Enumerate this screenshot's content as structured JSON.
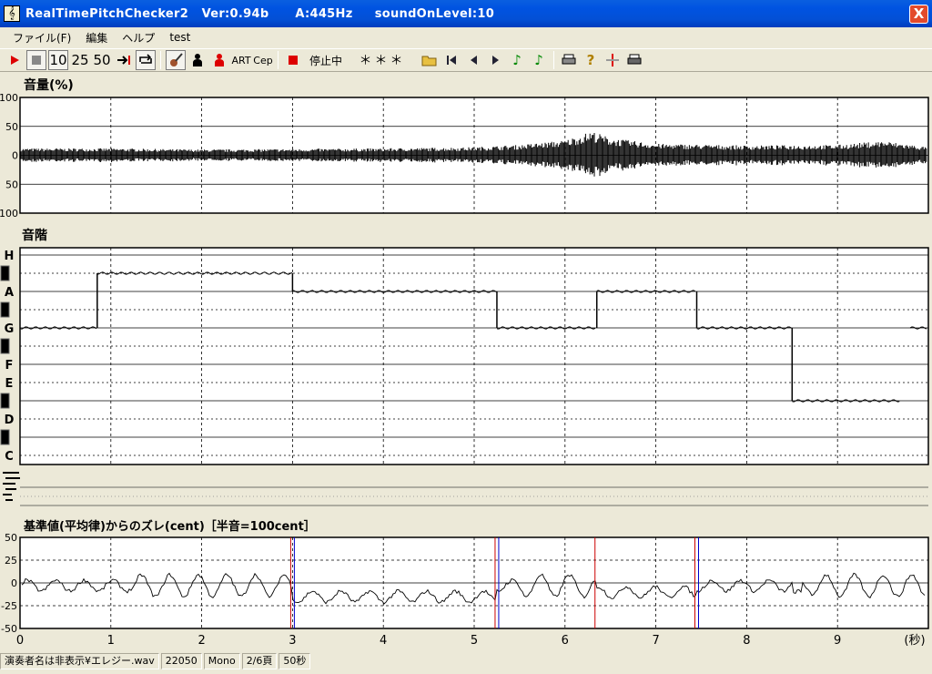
{
  "window": {
    "title": "RealTimePitchChecker2   Ver:0.94b      A:445Hz     soundOnLevel:10",
    "app_icon": "treble-clef-icon",
    "close_label": "X"
  },
  "menu": [
    "ファイル(F)",
    "編集",
    "ヘルプ",
    "test"
  ],
  "toolbar": {
    "play": "play-icon",
    "stop": "stop-icon",
    "speed": [
      "10",
      "25",
      "50"
    ],
    "art": "ART",
    "cep": "Cep",
    "state": "停止中",
    "pitch_display": "＊＊＊"
  },
  "panels": {
    "volume": {
      "title": "音量(%)",
      "y_ticks": [
        "100",
        "50",
        "0",
        "50",
        "100"
      ]
    },
    "scale": {
      "title": "音階",
      "notes": [
        "H",
        "A",
        "G",
        "F",
        "E",
        "D",
        "C"
      ]
    },
    "deviation": {
      "title": "基準値(平均律)からのズレ(cent)［半音=100cent］",
      "y_ticks": [
        "50",
        "25",
        "0",
        "-25",
        "-50"
      ]
    },
    "time_axis": {
      "ticks": [
        "0",
        "1",
        "2",
        "3",
        "4",
        "5",
        "6",
        "7",
        "8",
        "9"
      ],
      "unit": "(秒)"
    }
  },
  "statusbar": {
    "file": "演奏者名は非表示¥エレジー.wav",
    "rate": "22050",
    "channels": "Mono",
    "page": "2/6頁",
    "duration": "50秒"
  },
  "colors": {
    "titlebar": "#0053e1",
    "red_marker": "#cc0000",
    "blue_marker": "#0000cc"
  },
  "chart_data": {
    "type": "line",
    "x_range": [
      0,
      10
    ],
    "x_unit": "秒",
    "pitch_segments": [
      {
        "note": "G",
        "x": [
          0,
          0.85
        ]
      },
      {
        "note": "A#",
        "x": [
          0.85,
          3.0
        ]
      },
      {
        "note": "A",
        "x": [
          3.0,
          5.25
        ]
      },
      {
        "note": "G",
        "x": [
          5.25,
          6.35
        ]
      },
      {
        "note": "A",
        "x": [
          6.35,
          7.45
        ]
      },
      {
        "note": "G",
        "x": [
          7.45,
          8.5
        ]
      },
      {
        "note": "D#",
        "x": [
          8.5,
          9.7
        ]
      },
      {
        "note": "G",
        "x": [
          9.8,
          10
        ]
      }
    ],
    "volume_envelope": {
      "x": [
        0,
        1,
        2,
        3,
        4,
        5,
        5.5,
        6,
        6.3,
        6.5,
        7,
        8,
        9,
        9.5,
        10
      ],
      "y": [
        12,
        12,
        10,
        11,
        12,
        14,
        18,
        26,
        42,
        30,
        20,
        17,
        18,
        25,
        14
      ]
    },
    "deviation_markers": [
      {
        "x": 3.0
      },
      {
        "x": 5.25
      },
      {
        "x": 7.45
      },
      {
        "x": 6.35
      }
    ]
  }
}
